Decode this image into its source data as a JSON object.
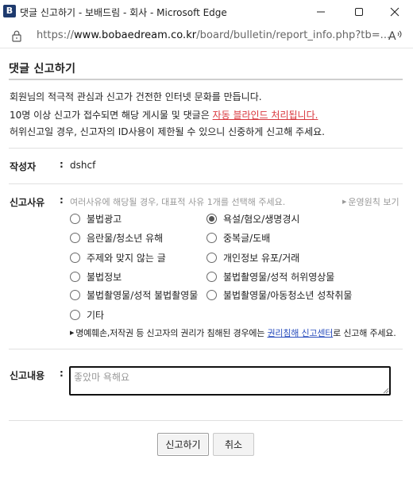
{
  "window": {
    "app_icon_letter": "B",
    "title": "댓글 신고하기 - 보배드림 - 회사 - Microsoft Edge",
    "icons": [
      "minimize-icon",
      "maximize-icon",
      "close-icon"
    ]
  },
  "address_bar": {
    "url_prefix": "https://",
    "url_host": "www.bobaedream.co.kr",
    "url_path": "/board/bulletin/report_info.php?tb=..."
  },
  "page": {
    "title": "댓글 신고하기",
    "notice": {
      "line1": "회원님의 적극적 관심과 신고가 건전한 인터넷 문화를 만듭니다.",
      "line2_prefix": "10명 이상 신고가 접수되면 해당 게시물 및 댓글은 ",
      "line2_highlight": "자동 블라인드 처리됩니다.",
      "line3": "허위신고일 경우, 신고자의 ID사용이 제한될 수 있으니 신중하게 신고해 주세요."
    },
    "author": {
      "label": "작성자",
      "colon": ":",
      "value": "dshcf"
    },
    "reason": {
      "label": "신고사유",
      "colon": ":",
      "hint": "여러사유에 해당될 경우, 대표적 사유 1개를 선택해 주세요.",
      "policy_link": "운영원칙 보기",
      "options": [
        "불법광고",
        "욕설/혐오/생명경시",
        "음란물/청소년 유해",
        "중복글/도배",
        "주제와 맞지 않는 글",
        "개인정보 유포/거래",
        "불법정보",
        "불법촬영물/성적 허위영상물",
        "불법촬영물/성적 불법촬영물",
        "불법촬영물/아동청소년 성착취물",
        "기타"
      ],
      "selected": "욕설/혐오/생명경시",
      "copyright_note_prefix": "명예훼손,저작권 등 신고자의 권리가 침해된 경우에는 ",
      "copyright_link": "권리침해 신고센터",
      "copyright_note_suffix": "로 신고해 주세요."
    },
    "content": {
      "label": "신고내용",
      "colon": ":",
      "value": "",
      "placeholder": "좋았마 욕해요"
    },
    "buttons": {
      "submit": "신고하기",
      "cancel": "취소"
    }
  }
}
